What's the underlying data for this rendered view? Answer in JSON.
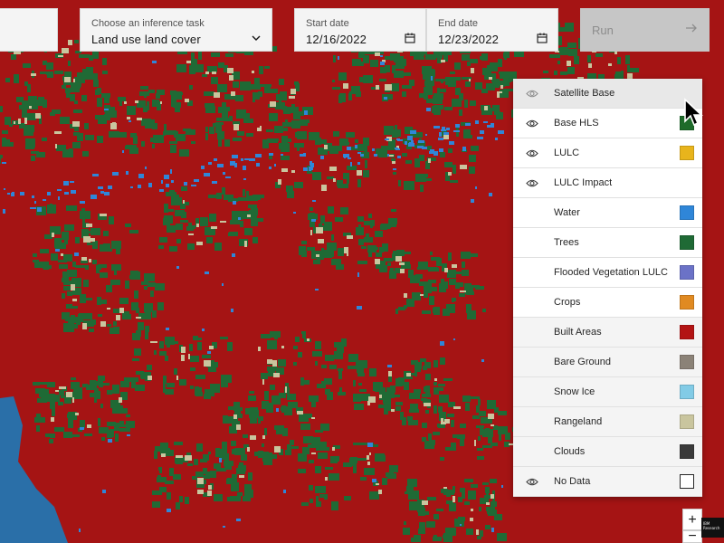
{
  "controls": {
    "task_label": "Choose an inference task",
    "task_value": "Land use land cover",
    "start_label": "Start date",
    "start_value": "12/16/2022",
    "end_label": "End date",
    "end_value": "12/23/2022",
    "run_label": "Run"
  },
  "legend": {
    "items": [
      {
        "label": "Satellite Base",
        "eye": true,
        "color": null
      },
      {
        "label": "Base HLS",
        "eye": true,
        "color": "#1e6b2a"
      },
      {
        "label": "LULC",
        "eye": true,
        "color": "#e8b41c"
      },
      {
        "label": "LULC Impact",
        "eye": true,
        "color": null
      },
      {
        "label": "Water",
        "eye": false,
        "color": "#2f86d8"
      },
      {
        "label": "Trees",
        "eye": false,
        "color": "#1f6a35"
      },
      {
        "label": "Flooded Vegetation LULC",
        "eye": false,
        "color": "#6b72c7"
      },
      {
        "label": "Crops",
        "eye": false,
        "color": "#e08a22"
      },
      {
        "label": "Built Areas",
        "eye": false,
        "color": "#b31414"
      },
      {
        "label": "Bare Ground",
        "eye": false,
        "color": "#8b8277"
      },
      {
        "label": "Snow Ice",
        "eye": false,
        "color": "#82cbe6"
      },
      {
        "label": "Rangeland",
        "eye": false,
        "color": "#c9c59e"
      },
      {
        "label": "Clouds",
        "eye": false,
        "color": "#3a3a3a"
      },
      {
        "label": "No Data",
        "eye": true,
        "color": "empty"
      }
    ]
  },
  "zoom": {
    "in_label": "+",
    "out_label": "−"
  },
  "logo_text": "IBM Research",
  "map_colors": {
    "built": "#a51414",
    "trees": "#1f6a35",
    "water": "#2f86d8",
    "range": "#c9c59e",
    "lake": "#2a6fa8"
  }
}
